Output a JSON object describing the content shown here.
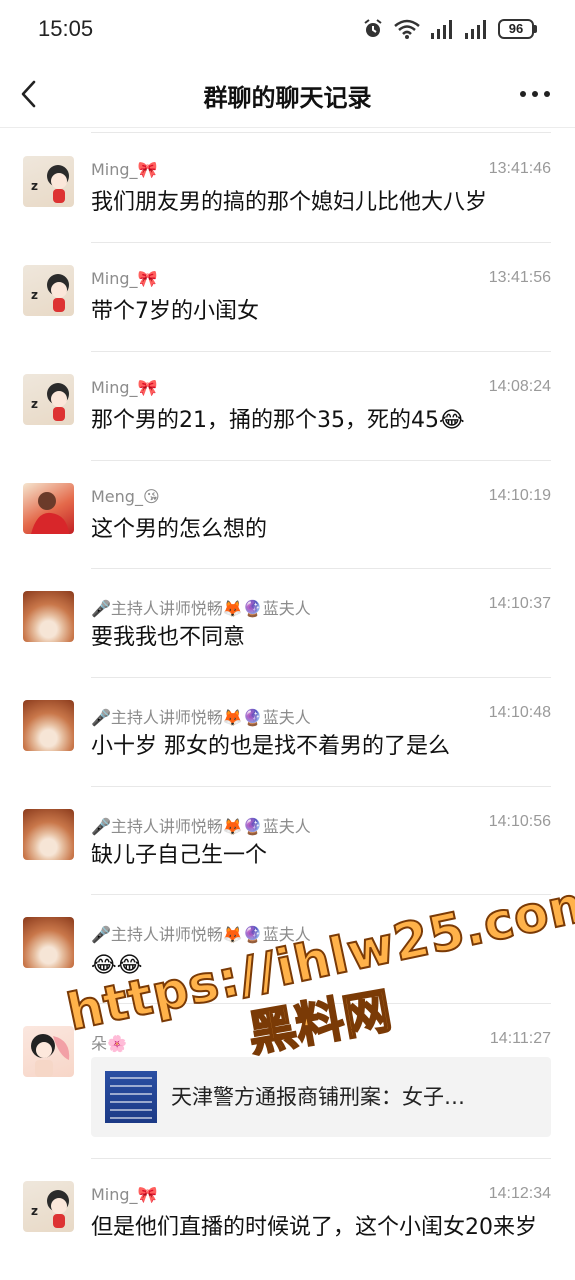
{
  "status_bar": {
    "time": "15:05",
    "battery": "96"
  },
  "nav": {
    "title": "群聊的聊天记录"
  },
  "messages": [
    {
      "sender": "Ming_🎀",
      "time": "13:41:46",
      "text": "我们朋友男的搞的那个媳妇儿比他大八岁"
    },
    {
      "sender": "Ming_🎀",
      "time": "13:41:56",
      "text": "带个7岁的小闺女"
    },
    {
      "sender": "Ming_🎀",
      "time": "14:08:24",
      "text": "那个男的21，捅的那个35，死的45😂"
    },
    {
      "sender": "Meng_😘",
      "time": "14:10:19",
      "text": "这个男的怎么想的"
    },
    {
      "sender": "🎤主持人讲师悦畅🦊🔮蓝夫人",
      "time": "14:10:37",
      "text": "要我我也不同意"
    },
    {
      "sender": "🎤主持人讲师悦畅🦊🔮蓝夫人",
      "time": "14:10:48",
      "text": "小十岁 那女的也是找不着男的了是么"
    },
    {
      "sender": "🎤主持人讲师悦畅🦊🔮蓝夫人",
      "time": "14:10:56",
      "text": "缺儿子自己生一个"
    },
    {
      "sender": "🎤主持人讲师悦畅🦊🔮蓝夫人",
      "time": "",
      "text": "😂😂"
    },
    {
      "sender": "朵🌸",
      "time": "14:11:27",
      "link_title": "天津警方通报商铺刑案：女子…"
    },
    {
      "sender": "Ming_🎀",
      "time": "14:12:34",
      "text": "但是他们直播的时候说了，这个小闺女20来岁"
    }
  ],
  "watermark": {
    "url": "https://ihlw25.com",
    "label": "黑料网"
  },
  "icons": {
    "back": "back-arrow-icon",
    "more": "more-icon",
    "alarm": "alarm-icon",
    "wifi": "wifi-icon",
    "signal": "signal-icon",
    "battery": "battery-icon"
  }
}
